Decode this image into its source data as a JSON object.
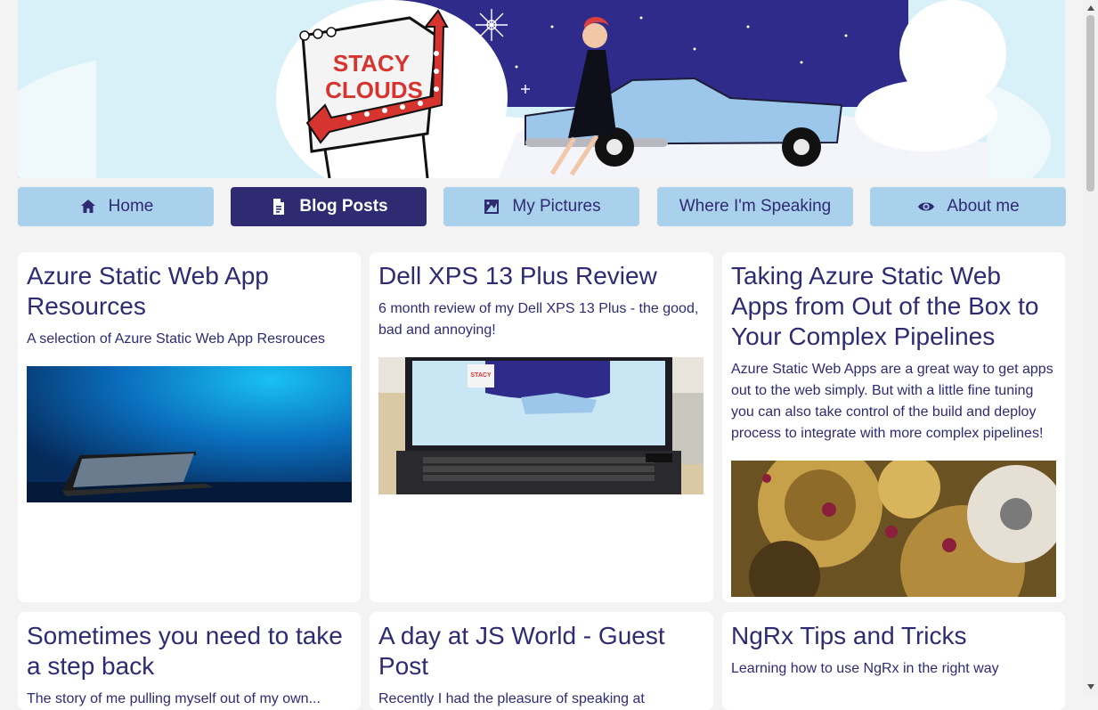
{
  "banner": {
    "sign_text_line1": "STACY",
    "sign_text_line2": "CLOUDS"
  },
  "nav": {
    "items": [
      {
        "label": "Home",
        "icon": "home-icon"
      },
      {
        "label": "Blog Posts",
        "icon": "document-icon",
        "active": true
      },
      {
        "label": "My Pictures",
        "icon": "picture-icon"
      },
      {
        "label": "Where I'm Speaking",
        "icon": ""
      },
      {
        "label": "About me",
        "icon": "eye-icon"
      }
    ]
  },
  "posts": [
    {
      "title": "Azure Static Web App Resources",
      "summary": "A selection of Azure Static Web App Resrouces"
    },
    {
      "title": "Dell XPS 13 Plus Review",
      "summary": "6 month review of my Dell XPS 13 Plus - the good, bad and annoying!"
    },
    {
      "title": "Taking Azure Static Web Apps from Out of the Box to Your Complex Pipelines",
      "summary": "Azure Static Web Apps are a great way to get apps out to the web simply. But with a little fine tuning you can also take control of the build and deploy process to integrate with more complex pipelines!"
    },
    {
      "title": "Sometimes you need to take a step back",
      "summary": "The story of me pulling myself out of my own..."
    },
    {
      "title": "A day at JS World - Guest Post",
      "summary": "Recently I had the pleasure of speaking at JSWorld..."
    },
    {
      "title": "NgRx Tips and Tricks",
      "summary": "Learning how to use NgRx in the right way"
    }
  ],
  "colors": {
    "primary": "#2e2b73",
    "nav_bg": "#a9d1ec",
    "page_bg": "#f3f3f3",
    "card_bg": "#ffffff"
  }
}
